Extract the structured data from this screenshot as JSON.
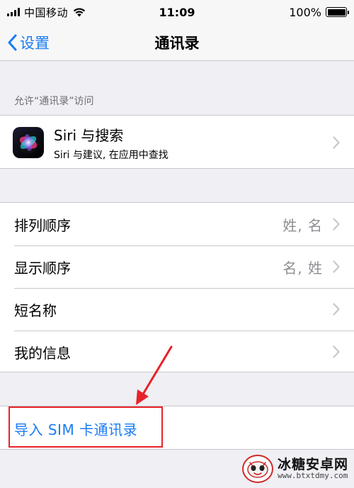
{
  "status_bar": {
    "carrier": "中国移动",
    "time": "11:09",
    "battery_percent": "100%",
    "battery_level": 1.0
  },
  "nav": {
    "back_label": "设置",
    "title": "通讯录"
  },
  "section": {
    "header": "允许“通讯录”访问"
  },
  "siri": {
    "title": "Siri 与搜索",
    "subtitle": "Siri 与建议, 在应用中查找"
  },
  "settings_rows": [
    {
      "label": "排列顺序",
      "value": "姓, 名"
    },
    {
      "label": "显示顺序",
      "value": "名, 姓"
    },
    {
      "label": "短名称",
      "value": ""
    },
    {
      "label": "我的信息",
      "value": ""
    }
  ],
  "import": {
    "label": "导入 SIM 卡通讯录"
  },
  "watermark": {
    "title": "冰糖安卓网",
    "url": "www.btxtdmy.com"
  },
  "colors": {
    "accent": "#1a7cf5",
    "background": "#efeff4",
    "annotation": "#e8222a"
  }
}
